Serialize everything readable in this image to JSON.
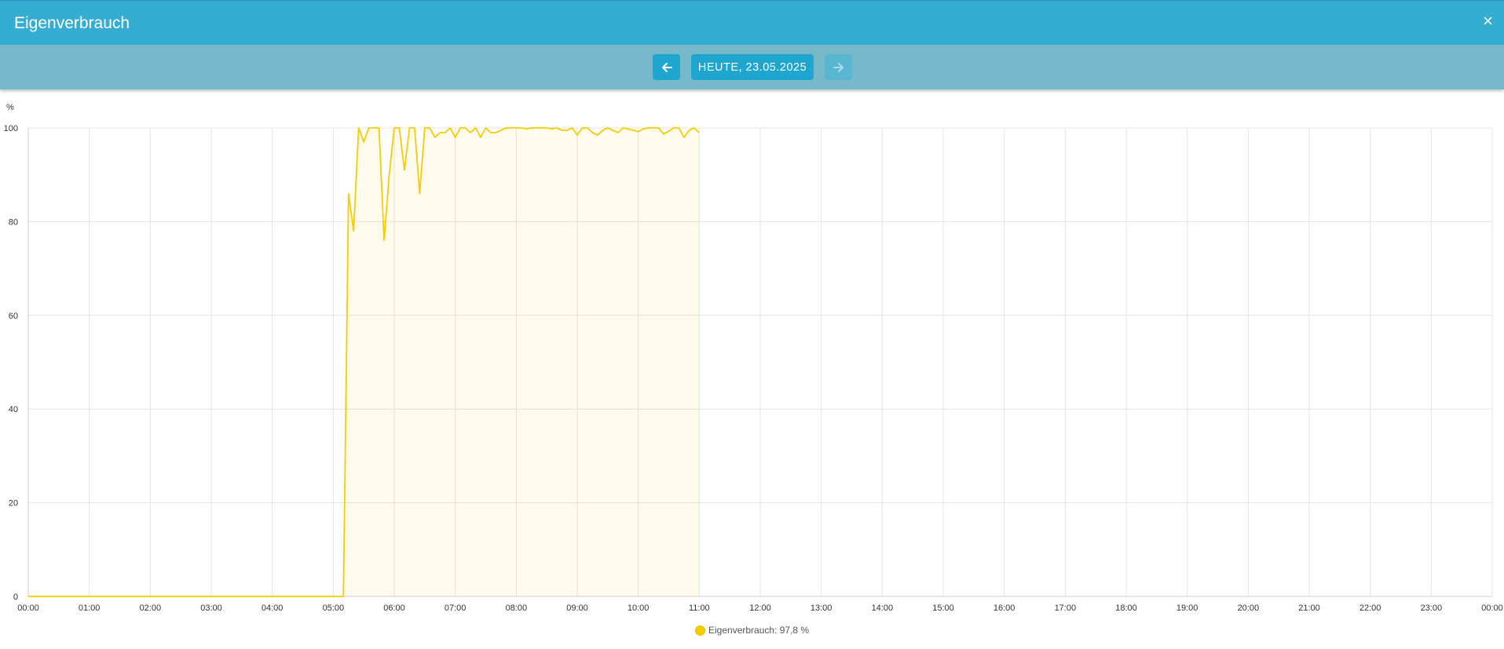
{
  "window": {
    "title": "Eigenverbrauch",
    "close_label": "×"
  },
  "toolbar": {
    "date_label": "HEUTE, 23.05.2025",
    "prev_icon": "arrow-left-icon",
    "next_icon": "arrow-right-icon"
  },
  "colors": {
    "header": "#35add2",
    "toolbar": "#77b8cb",
    "button": "#1fa6d0",
    "series": "#f6cc00"
  },
  "legend": {
    "text": "Eigenverbrauch: 97,8 %"
  },
  "chart_data": {
    "type": "area",
    "ylabel": "%",
    "ylim": [
      0,
      100
    ],
    "y_ticks": [
      0,
      20,
      40,
      60,
      80,
      100
    ],
    "x_ticks": [
      "00:00",
      "01:00",
      "02:00",
      "03:00",
      "04:00",
      "05:00",
      "06:00",
      "07:00",
      "08:00",
      "09:00",
      "10:00",
      "11:00",
      "12:00",
      "13:00",
      "14:00",
      "15:00",
      "16:00",
      "17:00",
      "18:00",
      "19:00",
      "20:00",
      "21:00",
      "22:00",
      "23:00",
      "00:00"
    ],
    "grid": true,
    "legend_position": "bottom",
    "series": [
      {
        "name": "Eigenverbrauch",
        "x": [
          "00:00",
          "05:10",
          "05:15",
          "05:20",
          "05:25",
          "05:30",
          "05:35",
          "05:40",
          "05:45",
          "05:50",
          "05:55",
          "06:00",
          "06:05",
          "06:10",
          "06:15",
          "06:20",
          "06:25",
          "06:30",
          "06:35",
          "06:40",
          "06:45",
          "06:50",
          "06:55",
          "07:00",
          "07:05",
          "07:10",
          "07:15",
          "07:20",
          "07:25",
          "07:30",
          "07:35",
          "07:40",
          "07:45",
          "07:50",
          "07:55",
          "08:00",
          "08:05",
          "08:10",
          "08:15",
          "08:20",
          "08:25",
          "08:30",
          "08:35",
          "08:40",
          "08:45",
          "08:50",
          "08:55",
          "09:00",
          "09:05",
          "09:10",
          "09:15",
          "09:20",
          "09:25",
          "09:30",
          "09:35",
          "09:40",
          "09:45",
          "09:50",
          "09:55",
          "10:00",
          "10:05",
          "10:10",
          "10:15",
          "10:20",
          "10:25",
          "10:30",
          "10:35",
          "10:40",
          "10:45",
          "10:50",
          "10:55",
          "11:00"
        ],
        "values": [
          0,
          0,
          86,
          78,
          100,
          97,
          100,
          100,
          100,
          76,
          90,
          100,
          100,
          91,
          100,
          100,
          86,
          100,
          100,
          98,
          99,
          99,
          100,
          98,
          100,
          100,
          99,
          100,
          98,
          100,
          99,
          99,
          99.5,
          100,
          100,
          100,
          100,
          99.8,
          100,
          100,
          100,
          100,
          99.8,
          100,
          99.5,
          99.5,
          100,
          98.5,
          100,
          100,
          99,
          98.5,
          99.5,
          100,
          99.5,
          99,
          100,
          99.8,
          99.5,
          99.2,
          99.8,
          100,
          100,
          100,
          98.7,
          99.3,
          100,
          100,
          98,
          99.5,
          100,
          99
        ]
      }
    ]
  }
}
